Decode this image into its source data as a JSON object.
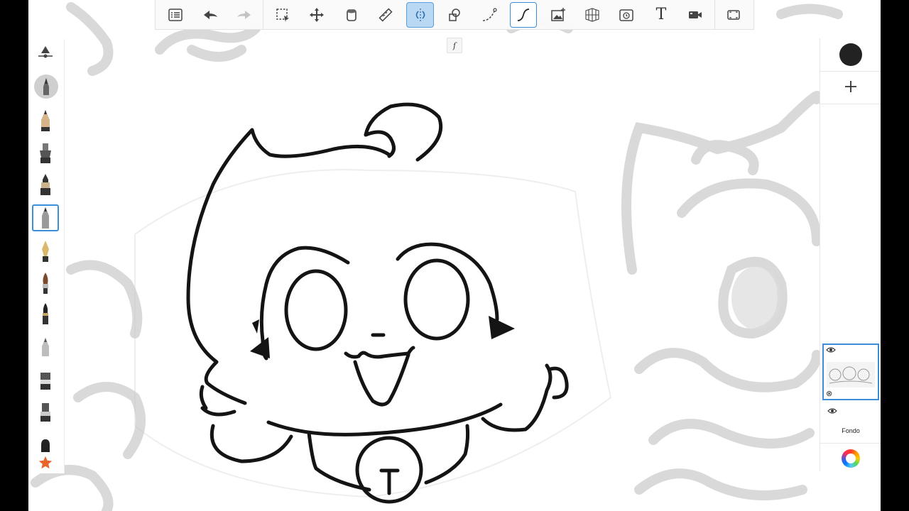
{
  "toolbar": {
    "items": [
      {
        "name": "menu-list-icon"
      },
      {
        "name": "undo-icon"
      },
      {
        "name": "redo-icon"
      },
      {
        "name": "selection-icon"
      },
      {
        "name": "transform-move-icon"
      },
      {
        "name": "fill-bucket-icon"
      },
      {
        "name": "ruler-icon"
      },
      {
        "name": "symmetry-icon",
        "state": "active"
      },
      {
        "name": "shapes-icon"
      },
      {
        "name": "curve-icon"
      },
      {
        "name": "predictive-stroke-icon",
        "state": "selected"
      },
      {
        "name": "add-image-icon"
      },
      {
        "name": "perspective-grid-icon"
      },
      {
        "name": "time-lapse-icon"
      },
      {
        "name": "text-tool-icon",
        "glyph": "T"
      },
      {
        "name": "record-video-icon"
      },
      {
        "name": "fullscreen-icon"
      }
    ],
    "sub_indicator": "ſ"
  },
  "brushes": [
    "pencil",
    "inking-pen",
    "marker",
    "technical-pen",
    "fine-liner",
    "fountain-pen",
    "paintbrush",
    "ink-brush",
    "eraser-tip",
    "flat-marker",
    "chisel-marker",
    "smudge",
    "favorites-star"
  ],
  "layers": {
    "layer_1_blend_icon": "⊗",
    "background_label": "Fondo"
  },
  "colors": {
    "active_color": "#222222",
    "accent": "#3b8fd9",
    "accent_fill": "#b9d8f3"
  }
}
